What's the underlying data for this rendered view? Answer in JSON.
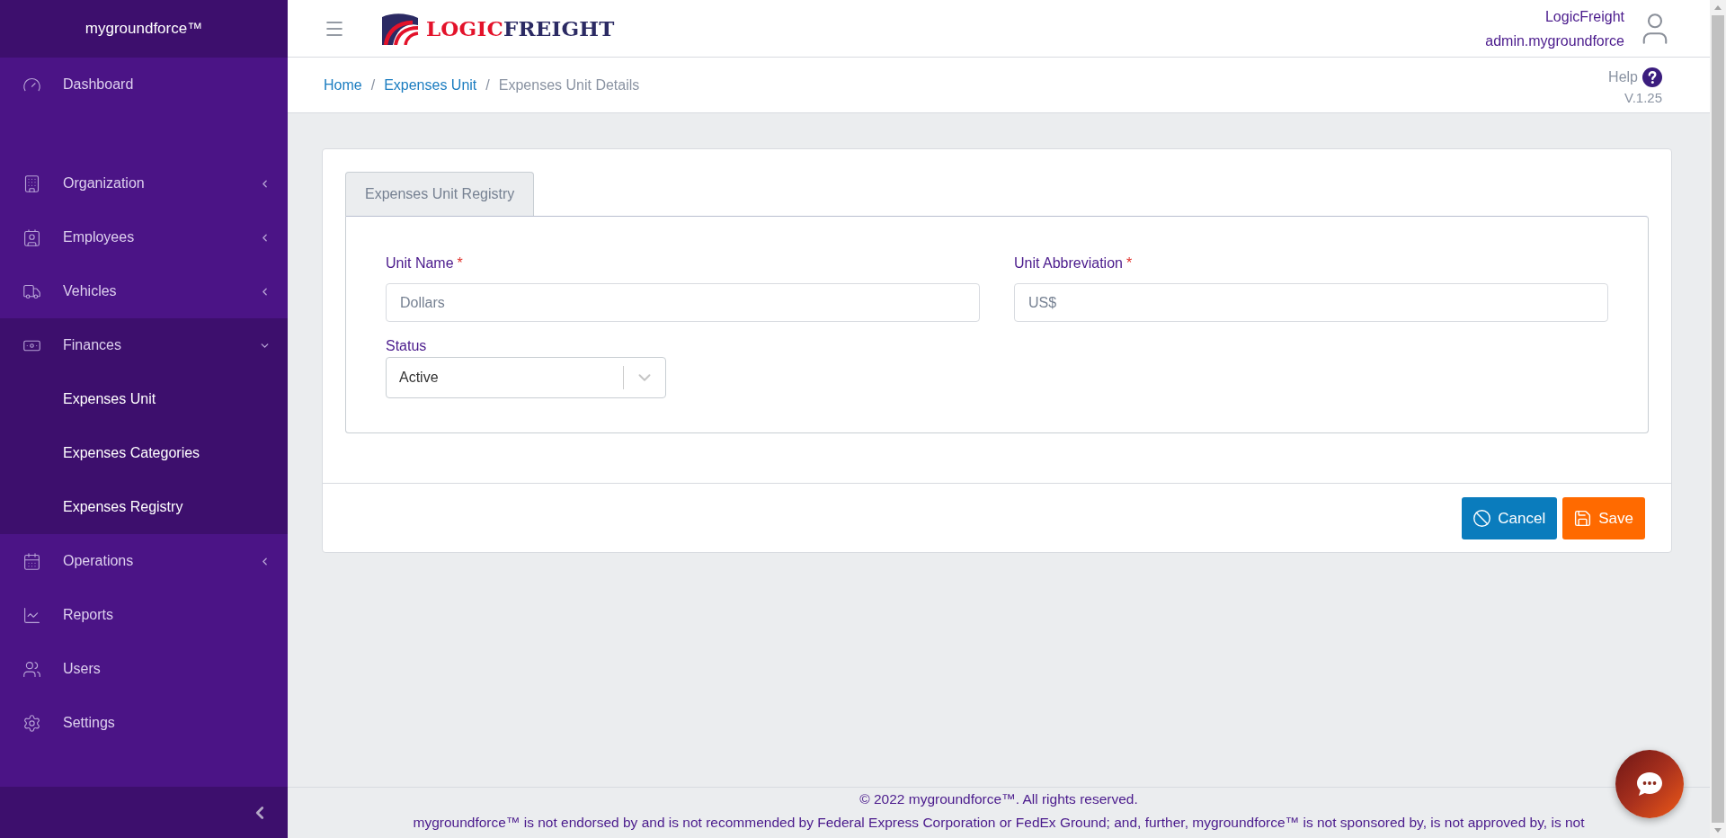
{
  "sidebar": {
    "brand": "mygroundforce™",
    "items": [
      {
        "label": "Dashboard",
        "kind": "link"
      },
      {
        "label": "Organization",
        "kind": "group",
        "expanded": false
      },
      {
        "label": "Employees",
        "kind": "group",
        "expanded": false
      },
      {
        "label": "Vehicles",
        "kind": "group",
        "expanded": false
      },
      {
        "label": "Finances",
        "kind": "group",
        "expanded": true,
        "children": [
          {
            "label": "Expenses Unit"
          },
          {
            "label": "Expenses Categories"
          },
          {
            "label": "Expenses Registry"
          }
        ]
      },
      {
        "label": "Operations",
        "kind": "group",
        "expanded": false
      },
      {
        "label": "Reports",
        "kind": "link"
      },
      {
        "label": "Users",
        "kind": "link"
      },
      {
        "label": "Settings",
        "kind": "link"
      }
    ]
  },
  "header": {
    "logo": [
      "LOGIC",
      "FREIGHT"
    ],
    "user": {
      "company": "LogicFreight",
      "username": "admin.mygroundforce"
    }
  },
  "breadcrumb": {
    "items": [
      {
        "label": "Home",
        "current": false
      },
      {
        "label": "Expenses Unit",
        "current": false
      },
      {
        "label": "Expenses Unit Details",
        "current": true
      }
    ],
    "separators": [
      "/",
      "/"
    ]
  },
  "help": {
    "label": "Help",
    "version": "V.1.25"
  },
  "form": {
    "tabs": [
      {
        "label": "Expenses Unit Registry",
        "selected": true
      }
    ],
    "fields": [
      {
        "label": "Unit Name",
        "required_mark": "*",
        "kind": "text",
        "value": "Dollars"
      },
      {
        "label": "Unit Abbreviation",
        "required_mark": "*",
        "kind": "text",
        "value": "US$"
      },
      {
        "label": "Status",
        "kind": "select",
        "value": "Active"
      }
    ],
    "buttons": [
      {
        "label": "Cancel",
        "kind": "cancel"
      },
      {
        "label": "Save",
        "kind": "save"
      }
    ]
  },
  "footer": {
    "copyright": "© 2022 mygroundforce™. All rights reserved.",
    "disclaimer": "mygroundforce™ is not endorsed by and is not recommended by Federal Express Corporation or FedEx Ground; and, further, mygroundforce™ is not sponsored by, is not approved by, is not"
  }
}
